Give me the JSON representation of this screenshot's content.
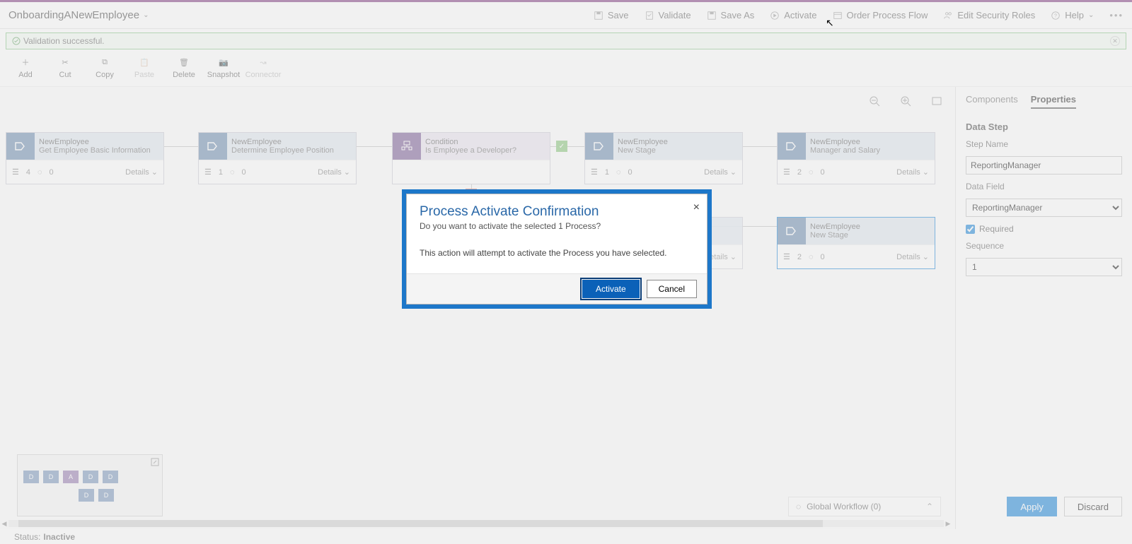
{
  "header": {
    "title": "OnboardingANewEmployee",
    "actions": {
      "save": "Save",
      "validate": "Validate",
      "saveAs": "Save As",
      "activate": "Activate",
      "orderFlow": "Order Process Flow",
      "editRoles": "Edit Security Roles",
      "help": "Help"
    }
  },
  "validation": {
    "message": "Validation successful."
  },
  "toolbar": {
    "add": "Add",
    "cut": "Cut",
    "copy": "Copy",
    "paste": "Paste",
    "delete": "Delete",
    "snapshot": "Snapshot",
    "connector": "Connector"
  },
  "stages": [
    {
      "entity": "NewEmployee",
      "name": "Get Employee Basic Information",
      "steps": "4",
      "triggers": "0",
      "details": "Details"
    },
    {
      "entity": "NewEmployee",
      "name": "Determine Employee Position",
      "steps": "1",
      "triggers": "0",
      "details": "Details"
    },
    {
      "entity": "Condition",
      "name": "Is Employee a Developer?",
      "steps": "",
      "triggers": "",
      "details": ""
    },
    {
      "entity": "NewEmployee",
      "name": "New Stage",
      "steps": "1",
      "triggers": "0",
      "details": "Details"
    },
    {
      "entity": "NewEmployee",
      "name": "Manager and Salary",
      "steps": "2",
      "triggers": "0",
      "details": "Details"
    },
    {
      "entity": "",
      "name": "",
      "steps": "",
      "triggers": "",
      "details": "Details"
    },
    {
      "entity": "NewEmployee",
      "name": "New Stage",
      "steps": "2",
      "triggers": "0",
      "details": "Details"
    }
  ],
  "globalWorkflow": "Global Workflow (0)",
  "sidebar": {
    "tabComponents": "Components",
    "tabProperties": "Properties",
    "heading": "Data Step",
    "stepNameLabel": "Step Name",
    "stepNameValue": "ReportingManager",
    "dataFieldLabel": "Data Field",
    "dataFieldValue": "ReportingManager",
    "requiredLabel": "Required",
    "sequenceLabel": "Sequence",
    "sequenceValue": "1",
    "apply": "Apply",
    "discard": "Discard"
  },
  "dialog": {
    "title": "Process Activate Confirmation",
    "subtitle": "Do you want to activate the selected 1 Process?",
    "body": "This action will attempt to activate the Process you have selected.",
    "activate": "Activate",
    "cancel": "Cancel"
  },
  "status": {
    "label": "Status:",
    "value": "Inactive"
  },
  "minimap": {
    "d": "D",
    "a": "A"
  }
}
